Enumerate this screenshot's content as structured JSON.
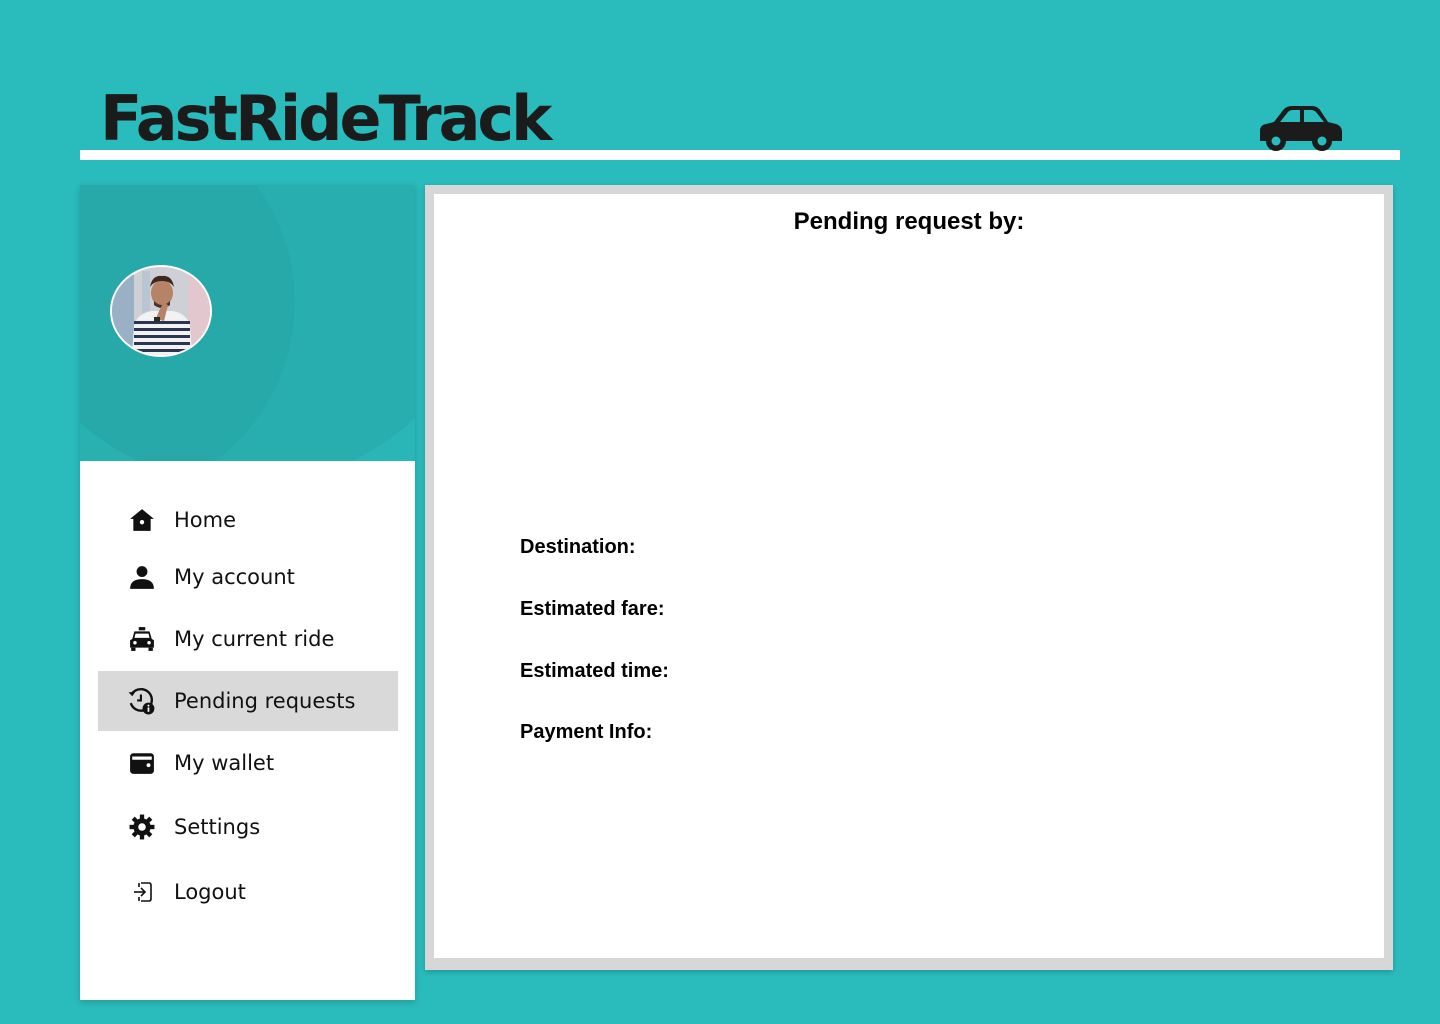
{
  "app": {
    "title": "FastRideTrack"
  },
  "sidebar": {
    "items": [
      {
        "label": "Home",
        "icon": "home-icon",
        "active": false
      },
      {
        "label": "My account",
        "icon": "user-icon",
        "active": false
      },
      {
        "label": "My current ride",
        "icon": "taxi-icon",
        "active": false
      },
      {
        "label": "Pending requests",
        "icon": "history-info-icon",
        "active": true
      },
      {
        "label": "My wallet",
        "icon": "wallet-icon",
        "active": false
      },
      {
        "label": "Settings",
        "icon": "gear-icon",
        "active": false
      },
      {
        "label": "Logout",
        "icon": "logout-icon",
        "active": false
      }
    ]
  },
  "main": {
    "title": "Pending request by:",
    "fields": [
      {
        "label": "Destination:"
      },
      {
        "label": "Estimated fare:"
      },
      {
        "label": "Estimated time:"
      },
      {
        "label": "Payment Info:"
      }
    ]
  },
  "colors": {
    "background": "#2abbbc",
    "active_item": "#d9d9d9",
    "text": "#111111"
  }
}
